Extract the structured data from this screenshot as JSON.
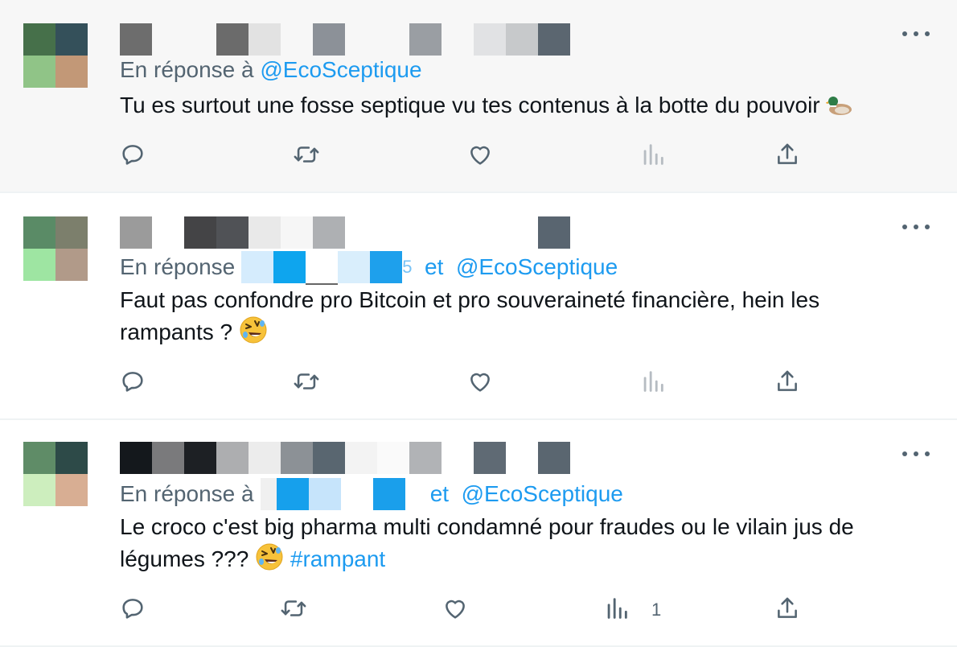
{
  "tweets": [
    {
      "reply_prefix": "En réponse à",
      "reply_to": "@EcoSceptique",
      "text": "Tu es surtout une fosse septique vu tes contenus à la botte du pouvoir",
      "emoji_icon": "duck-icon",
      "views_count": ""
    },
    {
      "reply_prefix": "En réponse",
      "reply_tail": "5",
      "conj": "et",
      "reply_to": "@EcoSceptique",
      "text": "Faut pas confondre pro Bitcoin et pro souveraineté financière, hein les rampants ?",
      "emoji_icon": "rolling-on-floor-laughing-icon",
      "views_count": ""
    },
    {
      "reply_prefix": "En réponse à",
      "conj": "et",
      "reply_to": "@EcoSceptique",
      "text": "Le croco c'est big pharma multi condamné pour fraudes ou le vilain jus de légumes ???",
      "emoji_icon": "rolling-on-floor-laughing-icon",
      "hashtag": "#rampant",
      "views_count": "1"
    }
  ],
  "colors": {
    "link": "#1d9bf0",
    "secondary_text": "#536471",
    "highlight_background": "#f7f7f7",
    "divider": "#eff3f4"
  },
  "icons": [
    "reply-icon",
    "retweet-icon",
    "like-icon",
    "views-icon",
    "share-icon",
    "more-icon"
  ]
}
